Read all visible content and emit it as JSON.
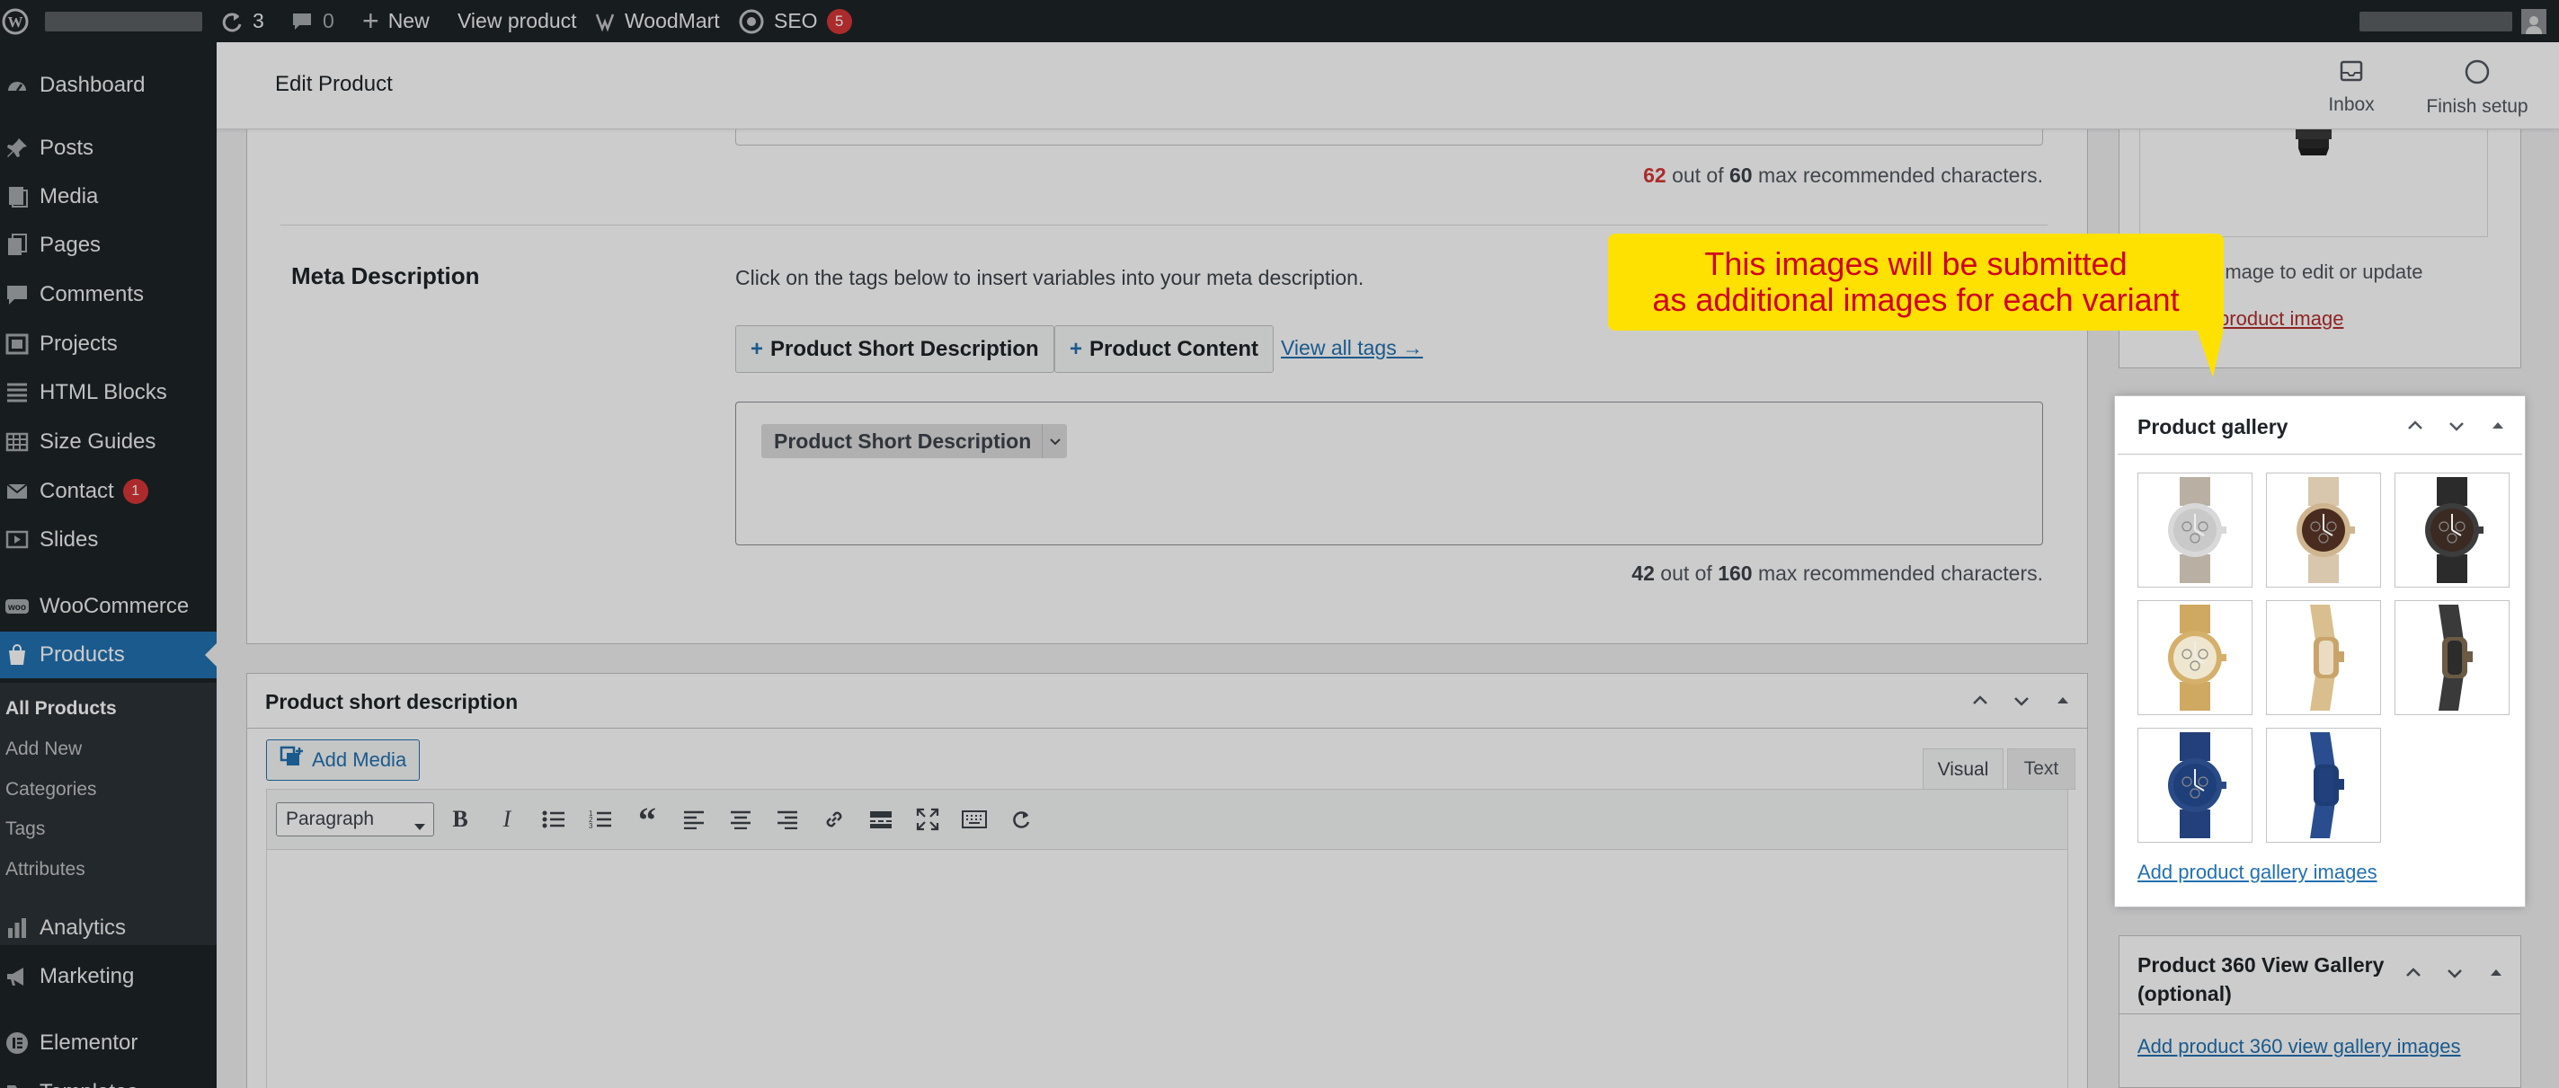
{
  "admin_bar": {
    "updates": "3",
    "comments": "0",
    "new_label": "New",
    "view_product": "View product",
    "woodmart": "WoodMart",
    "seo": "SEO",
    "seo_badge": "5"
  },
  "sidebar": {
    "items": [
      {
        "label": "Dashboard",
        "icon": "dashboard-icon"
      },
      {
        "label": "Posts",
        "icon": "pin-icon"
      },
      {
        "label": "Media",
        "icon": "media-icon"
      },
      {
        "label": "Pages",
        "icon": "pages-icon"
      },
      {
        "label": "Comments",
        "icon": "comment-icon"
      },
      {
        "label": "Projects",
        "icon": "portfolio-icon"
      },
      {
        "label": "HTML Blocks",
        "icon": "grid-icon"
      },
      {
        "label": "Size Guides",
        "icon": "table-icon"
      },
      {
        "label": "Contact",
        "icon": "mail-icon",
        "count": "1"
      },
      {
        "label": "Slides",
        "icon": "slides-icon"
      },
      {
        "label": "WooCommerce",
        "icon": "woo-icon"
      },
      {
        "label": "Products",
        "icon": "bag-icon"
      },
      {
        "label": "Analytics",
        "icon": "chart-icon"
      },
      {
        "label": "Marketing",
        "icon": "megaphone-icon"
      },
      {
        "label": "Elementor",
        "icon": "elementor-icon"
      },
      {
        "label": "Templates",
        "icon": "folder-icon"
      }
    ],
    "products_submenu": [
      "All Products",
      "Add New",
      "Categories",
      "Tags",
      "Attributes"
    ]
  },
  "header": {
    "title": "Edit Product",
    "inbox": "Inbox",
    "finish_setup": "Finish setup"
  },
  "seo": {
    "title_count": "62",
    "title_max": "60",
    "title_suffix": "max recommended characters.",
    "out_of": "out of",
    "meta_heading": "Meta Description",
    "meta_hint": "Click on the tags below to insert variables into your meta description.",
    "tag1": "Product Short Description",
    "tag2": "Product Content",
    "view_all": "View all tags →",
    "field_tag": "Product Short Description",
    "meta_count": "42",
    "meta_max": "160"
  },
  "short_description": {
    "heading": "Product short description",
    "add_media": "Add Media",
    "tab_visual": "Visual",
    "tab_text": "Text",
    "format": "Paragraph"
  },
  "product_image": {
    "click_text": "Click the image to edit or update",
    "remove": "Remove product image"
  },
  "gallery": {
    "heading": "Product gallery",
    "add_link": "Add product gallery images",
    "thumbs": [
      {
        "type": "watch",
        "dial": "#c9c9c9",
        "band": "#b9b0a3",
        "case": "#d8d8d8"
      },
      {
        "type": "watch",
        "dial": "#4a2b1f",
        "band": "#d8c6ad",
        "case": "#cfb58f"
      },
      {
        "type": "watch",
        "dial": "#3a2a22",
        "band": "#2b2b2b",
        "case": "#3c3c3c"
      },
      {
        "type": "watch",
        "dial": "#efe6cf",
        "band": "#cfa961",
        "case": "#d4b06b"
      },
      {
        "type": "side",
        "dial": "#e9dcc2",
        "band": "#d9bf8e",
        "case": "#c9a46a"
      },
      {
        "type": "side",
        "dial": "#2c2c2c",
        "band": "#3a3a3a",
        "case": "#6b5a44"
      },
      {
        "type": "watch",
        "dial": "#1f3f7a",
        "band": "#24407a",
        "case": "#294a86"
      },
      {
        "type": "side",
        "dial": "#22407c",
        "band": "#2a4d8f",
        "case": "#1e3d75"
      }
    ]
  },
  "view360": {
    "heading": "Product 360 View Gallery (optional)",
    "add_link": "Add product 360 view gallery images"
  },
  "callout": {
    "line1": "This images will be submitted",
    "line2": "as additional images for each variant"
  }
}
